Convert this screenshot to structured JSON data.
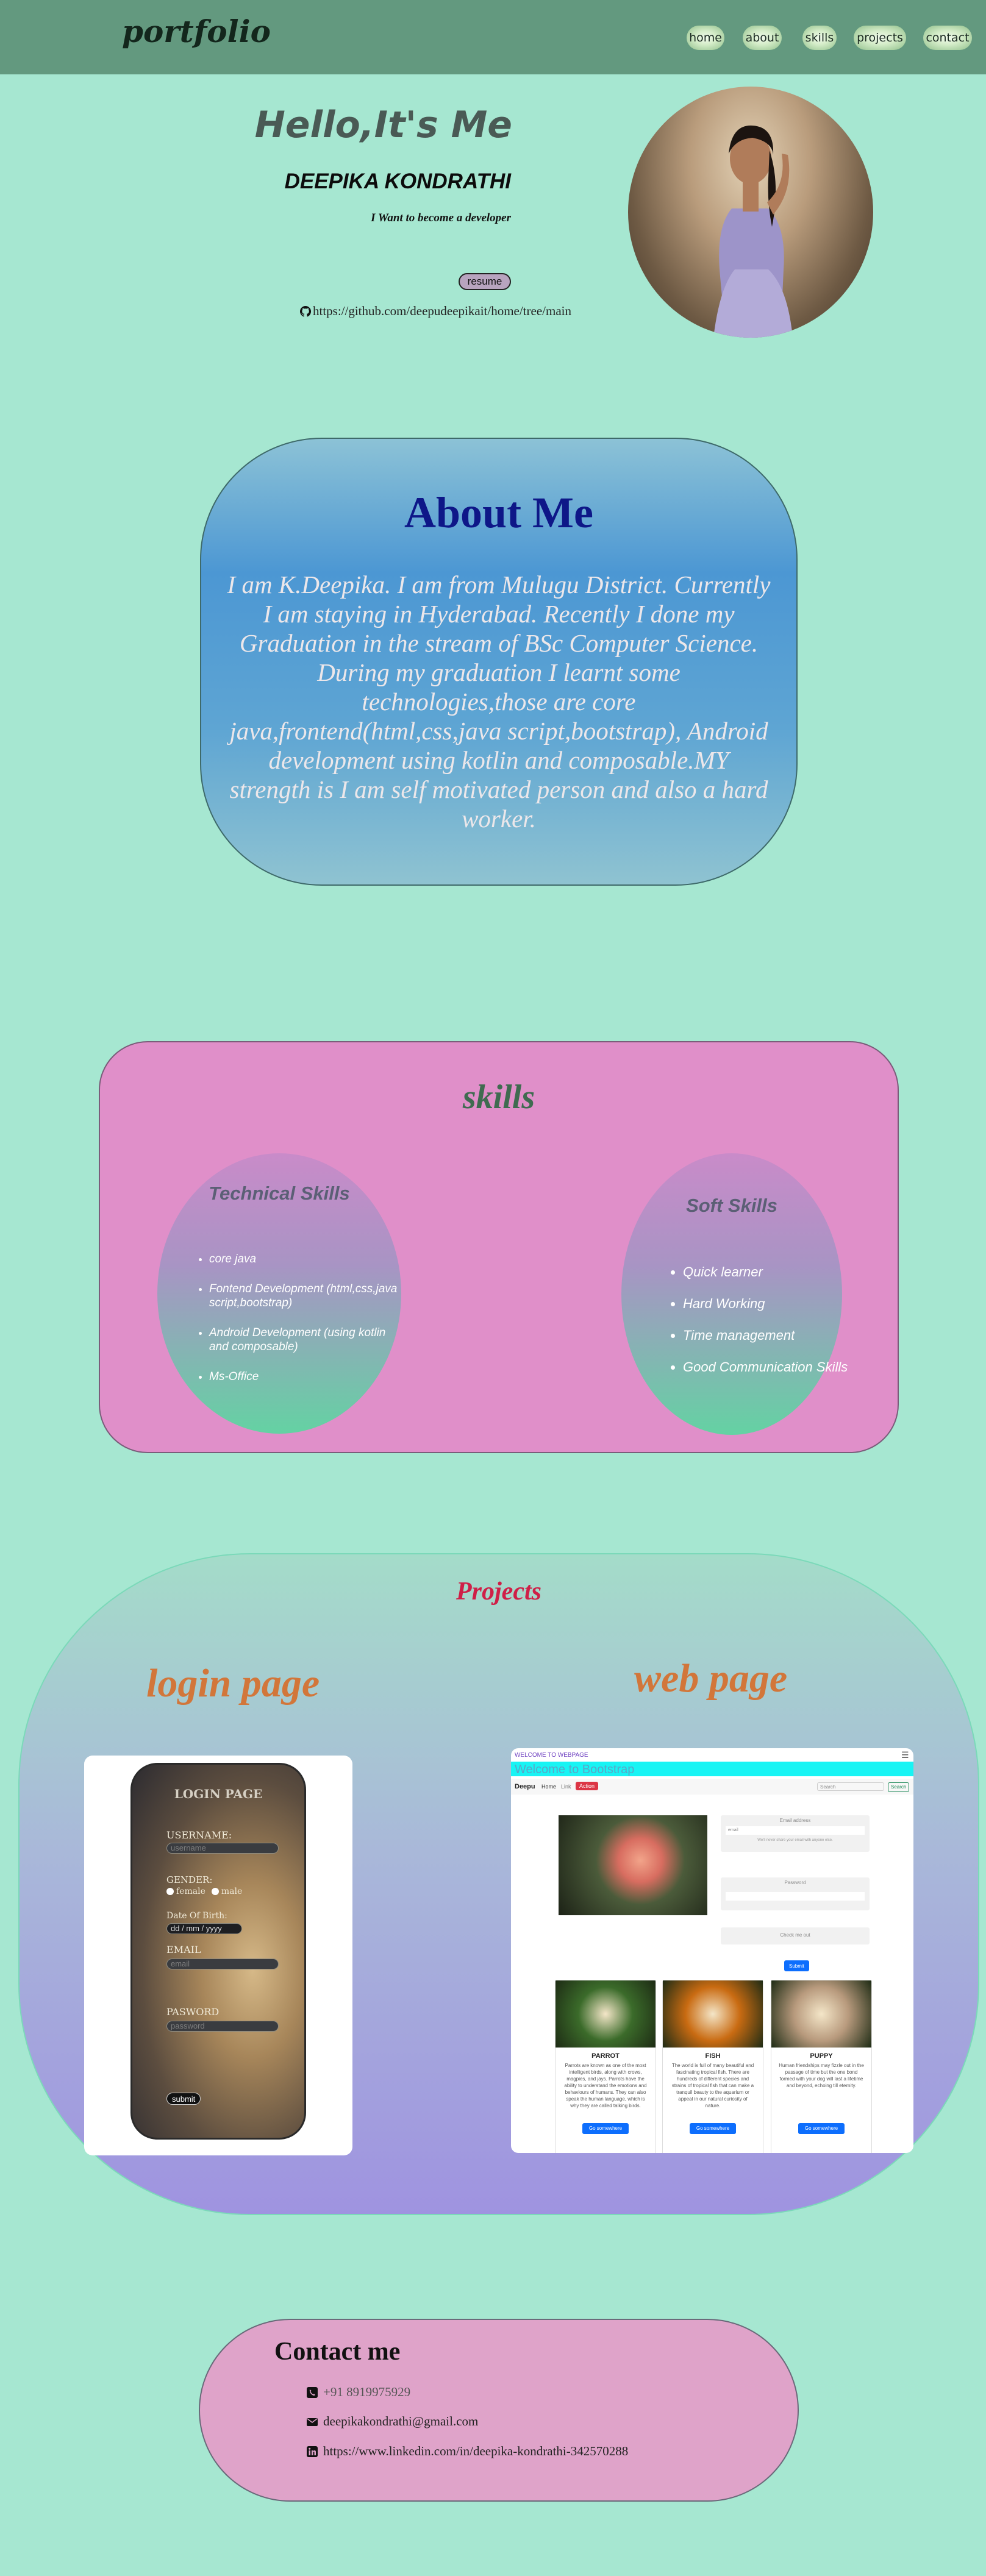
{
  "nav": {
    "logo": "portfolio",
    "items": [
      "home",
      "about",
      "skills",
      "projects",
      "contact"
    ]
  },
  "hero": {
    "greeting": "Hello,It's Me",
    "name": "DEEPIKA KONDRATHI",
    "tagline": "I Want to become a developer",
    "resume_label": "resume",
    "github_url": "https://github.com/deepudeepikait/home/tree/main"
  },
  "about": {
    "title": "About Me",
    "text": "I am K.Deepika. I am from Mulugu District. Currently I am staying in Hyderabad. Recently I done my Graduation in the stream of BSc Computer Science. During my graduation I learnt some technologies,those are core java,frontend(html,css,java script,bootstrap), Android development using kotlin and composable.MY strength is I am self motivated person and also a hard worker."
  },
  "skills": {
    "title": "skills",
    "technical": {
      "title": "Technical Skills",
      "items": [
        "core java",
        "Fontend Development (html,css,java script,bootstrap)",
        "Android Development (using kotlin and composable)",
        "Ms-Office"
      ]
    },
    "soft": {
      "title": "Soft Skills",
      "items": [
        "Quick learner",
        "Hard Working",
        "Time management",
        "Good Communication Skills"
      ]
    }
  },
  "projects": {
    "title": "Projects",
    "login": {
      "title": "login page",
      "screen": {
        "heading": "LOGIN PAGE",
        "username_label": "USERNAME:",
        "username_placeholder": "username",
        "gender_label": "GENDER:",
        "female": "female",
        "male": "male",
        "dob_label": "Date Of Birth:",
        "dob_placeholder": "dd / mm / yyyy",
        "email_label": "EMAIL",
        "email_placeholder": "email",
        "password_label": "PASWORD",
        "password_placeholder": "password",
        "submit": "submit"
      }
    },
    "web": {
      "title": "web page",
      "screen": {
        "topbar": "WELCOME TO WEBPAGE",
        "banner": "Welcome to Bootstrap",
        "brand": "Deepu",
        "nav": [
          "Home",
          "Link"
        ],
        "dropdown": "Action",
        "search_placeholder": "Search",
        "search_button": "Search",
        "email_label": "Email address",
        "email_hint": "We'll never share your email with anyone else.",
        "email_field": "email",
        "password_label": "Password",
        "check_label": "Check me out",
        "submit": "Submit",
        "cards": [
          {
            "title": "PARROT",
            "text": "Parrots are known as one of the most intelligent birds, along with crows, magpies, and jays. Parrots have the ability to understand the emotions and behaviours of humans. They can also speak the human language, which is why they are called talking birds.",
            "button": "Go somewhere",
            "color": "#3b6b2a"
          },
          {
            "title": "FISH",
            "text": "The world is full of many beautiful and fascinating tropical fish. There are hundreds of different species and strains of tropical fish that can make a tranquil beauty to the aquarium or appeal in our natural curiosity of nature.",
            "button": "Go somewhere",
            "color": "#c96b12"
          },
          {
            "title": "PUPPY",
            "text": "Human friendships may fizzle out in the passage of time but the one bond formed with your dog will last a lifetime and beyond, echoing till eternity.",
            "button": "Go somewhere",
            "color": "#b89a7d"
          }
        ]
      }
    }
  },
  "contact": {
    "title": "Contact me",
    "phone": "+91 8919975929",
    "email": "deepikakondrathi@gmail.com",
    "linkedin": "https://www.linkedin.com/in/deepika-kondrathi-342570288"
  }
}
